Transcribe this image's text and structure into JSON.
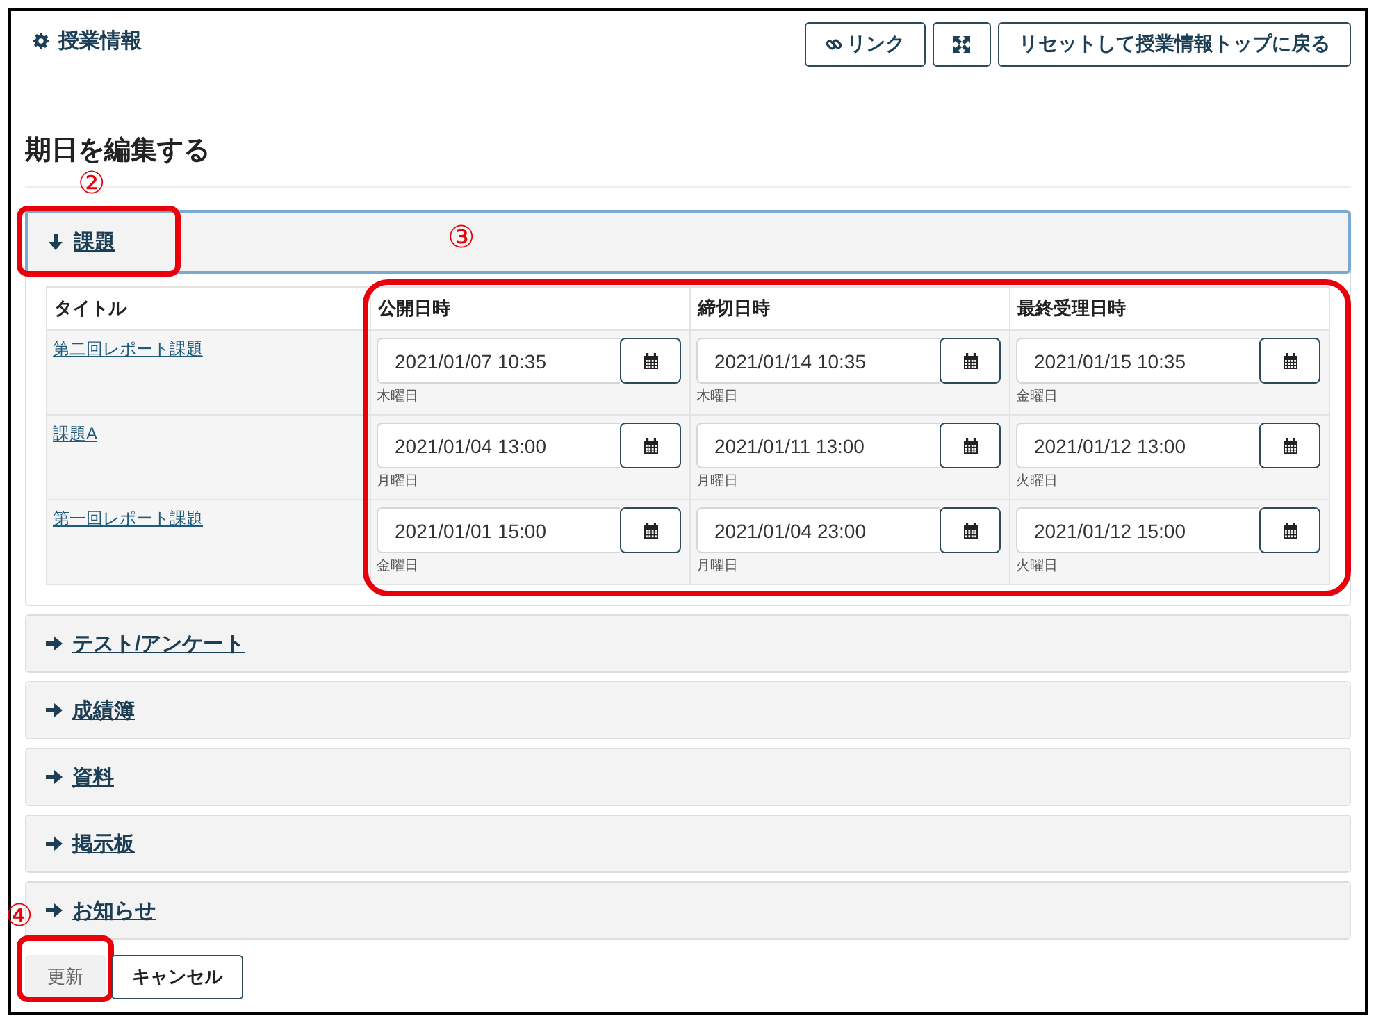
{
  "header": {
    "title": "授業情報",
    "buttons": [
      {
        "kind": "link",
        "label": "リンク"
      },
      {
        "kind": "expand"
      },
      {
        "kind": "text",
        "label": "リセットして授業情報トップに戻る"
      }
    ]
  },
  "page_title": "期日を編集する",
  "sections": [
    {
      "title": "課題",
      "expanded": true,
      "highlighted": true,
      "callouts": [
        "②",
        "③"
      ],
      "table": {
        "highlight_dates": true,
        "columns": [
          "タイトル",
          "公開日時",
          "締切日時",
          "最終受理日時"
        ],
        "rows": [
          {
            "title": "第二回レポート課題",
            "dates": [
              {
                "value": "2021/01/07 10:35",
                "weekday": "木曜日"
              },
              {
                "value": "2021/01/14 10:35",
                "weekday": "木曜日"
              },
              {
                "value": "2021/01/15 10:35",
                "weekday": "金曜日"
              }
            ]
          },
          {
            "title": "課題A",
            "dates": [
              {
                "value": "2021/01/04 13:00",
                "weekday": "月曜日"
              },
              {
                "value": "2021/01/11 13:00",
                "weekday": "月曜日"
              },
              {
                "value": "2021/01/12 13:00",
                "weekday": "火曜日"
              }
            ]
          },
          {
            "title": "第一回レポート課題",
            "dates": [
              {
                "value": "2021/01/01 15:00",
                "weekday": "金曜日"
              },
              {
                "value": "2021/01/04 23:00",
                "weekday": "月曜日"
              },
              {
                "value": "2021/01/12 15:00",
                "weekday": "火曜日"
              }
            ]
          }
        ]
      }
    },
    {
      "title": "テスト/アンケート",
      "expanded": false,
      "highlighted": false
    },
    {
      "title": "成績簿",
      "expanded": false,
      "highlighted": false
    },
    {
      "title": "資料",
      "expanded": false,
      "highlighted": false
    },
    {
      "title": "掲示板",
      "expanded": false,
      "highlighted": false
    },
    {
      "title": "お知らせ",
      "expanded": false,
      "highlighted": false
    }
  ],
  "actions": [
    {
      "label": "更新",
      "kind": "primary",
      "highlighted": true,
      "callout": "④"
    },
    {
      "label": "キャンセル",
      "kind": "secondary",
      "highlighted": false
    }
  ]
}
